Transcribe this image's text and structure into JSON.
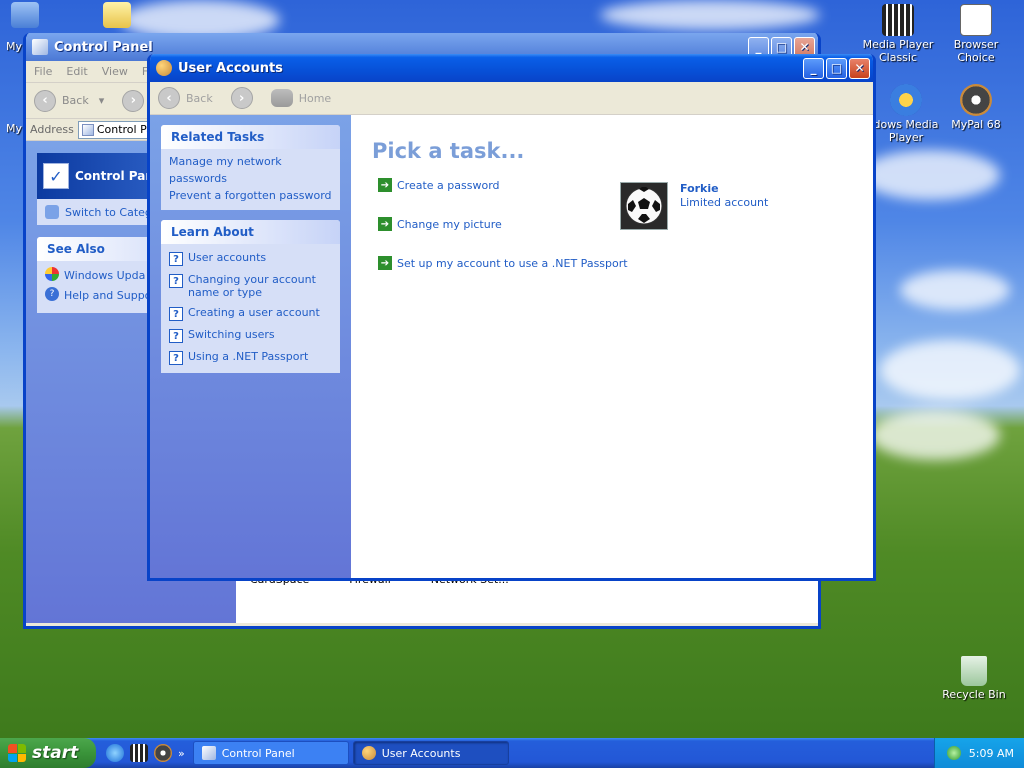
{
  "desktop": {
    "icons_left": [
      {
        "label": "My",
        "icon": "my-computer-icon"
      },
      {
        "label": "My",
        "icon": "my-documents-icon"
      }
    ],
    "icons_right": [
      {
        "label": "Media Player Classic",
        "icon": "media-player-classic-icon"
      },
      {
        "label": "Browser Choice",
        "icon": "browser-choice-icon"
      },
      {
        "label": "dows Media Player",
        "icon": "windows-media-player-icon"
      },
      {
        "label": "MyPal 68",
        "icon": "mypal-icon"
      },
      {
        "label": "Recycle Bin",
        "icon": "recycle-bin-icon"
      }
    ]
  },
  "control_panel": {
    "title": "Control Panel",
    "menu": [
      "File",
      "Edit",
      "View",
      "F"
    ],
    "back_label": "Back",
    "address_label": "Address",
    "address_value": "Control Pa",
    "panel_header": "Control Panel",
    "switch_link": "Switch to Categ",
    "see_also_header": "See Also",
    "see_also": [
      "Windows Upda",
      "Help and Suppo"
    ],
    "bottom_items": [
      "CardSpace",
      "Firewall",
      "Network Set..."
    ]
  },
  "user_accounts": {
    "title": "User Accounts",
    "back_label": "Back",
    "home_label": "Home",
    "related_tasks_header": "Related Tasks",
    "related_tasks": [
      "Manage my network passwords",
      "Prevent a forgotten password"
    ],
    "learn_about_header": "Learn About",
    "learn_about": [
      "User accounts",
      "Changing your account name or type",
      "Creating a user account",
      "Switching users",
      "Using a .NET Passport"
    ],
    "heading": "Pick a task...",
    "tasks": [
      "Create a password",
      "Change my picture",
      "Set up my account to use a .NET Passport"
    ],
    "account_name": "Forkie",
    "account_type": "Limited account"
  },
  "taskbar": {
    "start_label": "start",
    "buttons": [
      "Control Panel",
      "User Accounts"
    ],
    "clock": "5:09 AM"
  },
  "colors": {
    "accent": "#215dc6",
    "title_blue": "#0843c8",
    "heading_blue": "#7b9ed8",
    "start_green": "#3a943a"
  }
}
